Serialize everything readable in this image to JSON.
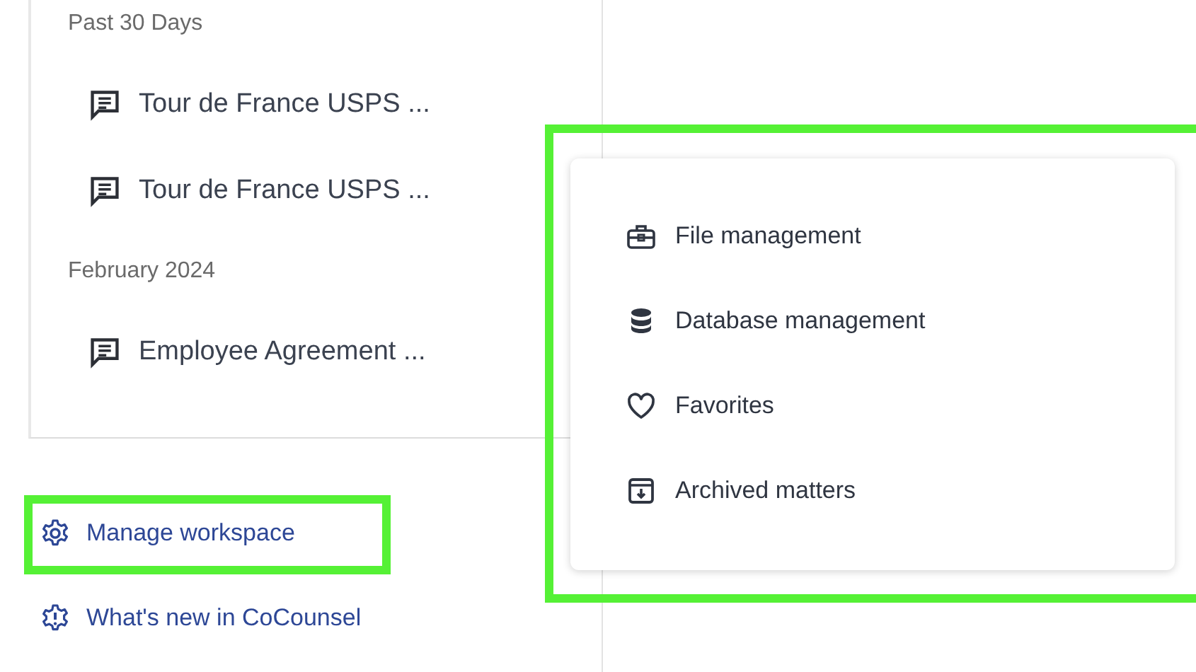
{
  "history": {
    "groups": [
      {
        "heading": "Past 30 Days",
        "items": [
          {
            "title": "Tour de France USPS ..."
          },
          {
            "title": "Tour de France USPS ..."
          }
        ]
      },
      {
        "heading": "February 2024",
        "items": [
          {
            "title": "Employee Agreement ..."
          }
        ]
      }
    ]
  },
  "footer_links": [
    {
      "kind": "settings",
      "label": "Manage workspace",
      "highlighted": true
    },
    {
      "kind": "news",
      "label": "What's new in CoCounsel",
      "highlighted": false
    }
  ],
  "menu": {
    "highlighted": true,
    "items": [
      {
        "kind": "briefcase",
        "label": "File management"
      },
      {
        "kind": "database",
        "label": "Database management"
      },
      {
        "kind": "heart",
        "label": "Favorites"
      },
      {
        "kind": "archive",
        "label": "Archived matters"
      }
    ]
  }
}
